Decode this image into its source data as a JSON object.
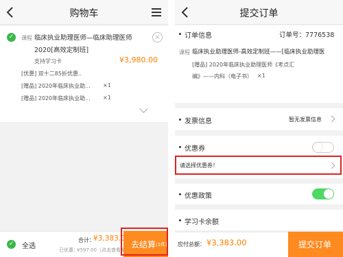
{
  "cart": {
    "title": "购物车",
    "item": {
      "tag": "课程",
      "name_line1": "临床执业助理医师—临床助理医师",
      "name_line2": "2020[高效定制班]",
      "support": "支持学习卡",
      "price": "¥3,980.00",
      "promo": "[优惠] 双十二85折优惠..",
      "gift1": "[赠品] 2020年临床执业助...",
      "gift1_qty": "×1",
      "gift2": "[赠品] 2020年临床执业助...",
      "gift2_qty": "×1"
    },
    "footer": {
      "select_all": "全选",
      "total_label": "合计：",
      "total_value": "¥3,383.00",
      "discount_label": "已优惠：",
      "discount_value": "¥597.00（点击查看明细）",
      "checkout": "去结算",
      "count": "(1件)"
    }
  },
  "order": {
    "title": "提交订单",
    "info_label": "订单信息",
    "order_no": "订单号：7776538",
    "course_tag": "课程",
    "course_name": "临床执业助理医师-高效定制班——[临床执业助理医",
    "gift_line1": "[赠品] 2020年临床执业助理医师《考点汇",
    "gift_line2": "编》——内科（电子书）",
    "gift_qty": "×1",
    "invoice_label": "发票信息",
    "invoice_value": "暂无发票信息",
    "coupon_label": "优惠券",
    "coupon_select": "请选择优惠券！",
    "policy_label": "优惠政策",
    "card_balance_label": "学习卡余额",
    "total_label": "应付总额：",
    "total_value": "¥3,383.00",
    "submit": "提交订单"
  },
  "colors": {
    "accent": "#ff8a1f",
    "green": "#3cb64b",
    "red_box": "#e02020"
  }
}
